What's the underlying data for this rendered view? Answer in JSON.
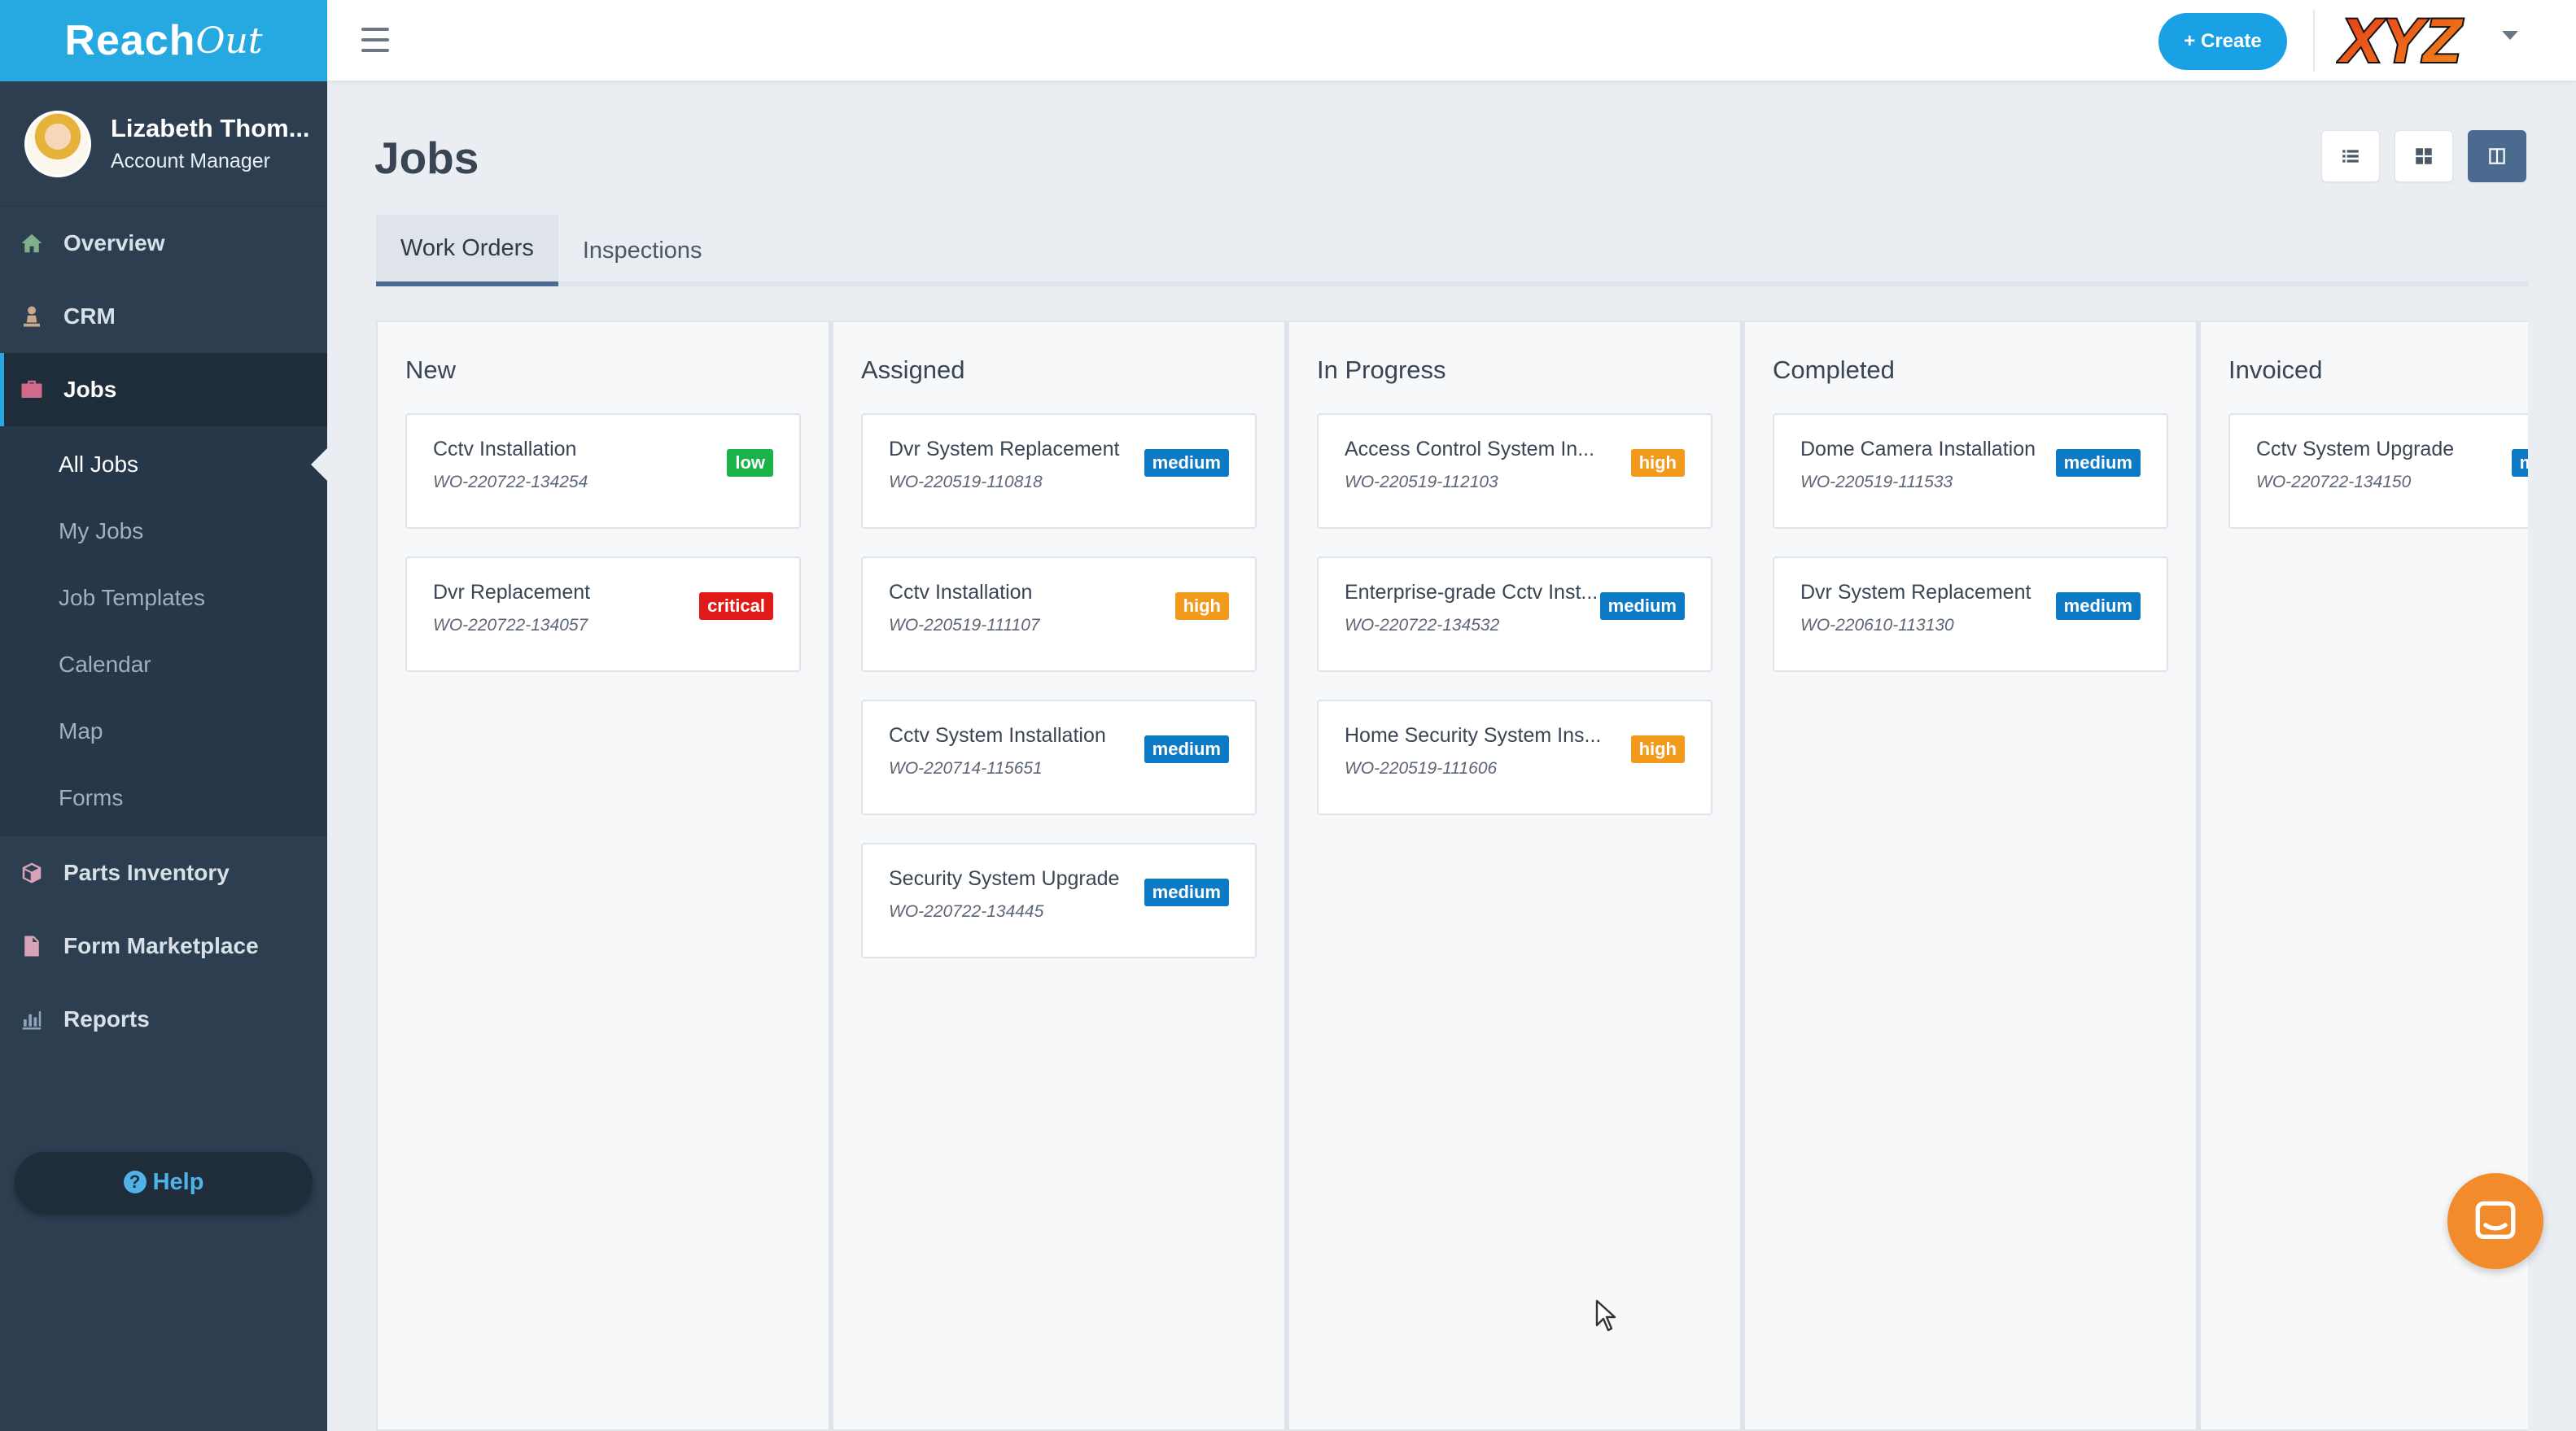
{
  "brand": {
    "logo_main": "Reach",
    "logo_tail": "Out",
    "color": "#25a9e0"
  },
  "user": {
    "name": "Lizabeth Thom...",
    "role": "Account Manager"
  },
  "nav": {
    "items": [
      {
        "label": "Overview",
        "icon": "home-icon"
      },
      {
        "label": "CRM",
        "icon": "person-icon"
      },
      {
        "label": "Jobs",
        "icon": "briefcase-icon"
      },
      {
        "label": "Parts Inventory",
        "icon": "box-icon"
      },
      {
        "label": "Form Marketplace",
        "icon": "document-icon"
      },
      {
        "label": "Reports",
        "icon": "bar-chart-icon"
      }
    ],
    "jobs_sub": [
      "All Jobs",
      "My Jobs",
      "Job Templates",
      "Calendar",
      "Map",
      "Forms"
    ]
  },
  "help": {
    "label": "Help"
  },
  "topbar": {
    "create_label": "+ Create",
    "company_logo": "XYZ"
  },
  "page": {
    "title": "Jobs"
  },
  "view_toggles": [
    "list-view-icon",
    "grid-view-icon",
    "board-view-icon"
  ],
  "tabs": [
    "Work Orders",
    "Inspections"
  ],
  "priority_colors": {
    "low": "#19b34a",
    "medium": "#0d7ac6",
    "high": "#f29a1c",
    "critical": "#e01919"
  },
  "board": {
    "columns": [
      {
        "title": "New",
        "cards": [
          {
            "title": "Cctv Installation",
            "code": "WO-220722-134254",
            "priority": "low"
          },
          {
            "title": "Dvr Replacement",
            "code": "WO-220722-134057",
            "priority": "critical"
          }
        ]
      },
      {
        "title": "Assigned",
        "cards": [
          {
            "title": "Dvr System Replacement",
            "code": "WO-220519-110818",
            "priority": "medium"
          },
          {
            "title": "Cctv Installation",
            "code": "WO-220519-111107",
            "priority": "high"
          },
          {
            "title": "Cctv System Installation",
            "code": "WO-220714-115651",
            "priority": "medium"
          },
          {
            "title": "Security System Upgrade",
            "code": "WO-220722-134445",
            "priority": "medium"
          }
        ]
      },
      {
        "title": "In Progress",
        "cards": [
          {
            "title": "Access Control System In...",
            "code": "WO-220519-112103",
            "priority": "high"
          },
          {
            "title": "Enterprise-grade Cctv Inst...",
            "code": "WO-220722-134532",
            "priority": "medium"
          },
          {
            "title": "Home Security System Ins...",
            "code": "WO-220519-111606",
            "priority": "high"
          }
        ]
      },
      {
        "title": "Completed",
        "cards": [
          {
            "title": "Dome Camera Installation",
            "code": "WO-220519-111533",
            "priority": "medium"
          },
          {
            "title": "Dvr System Replacement",
            "code": "WO-220610-113130",
            "priority": "medium"
          }
        ]
      },
      {
        "title": "Invoiced",
        "cards": [
          {
            "title": "Cctv System Upgrade",
            "code": "WO-220722-134150",
            "priority": "medium"
          }
        ]
      }
    ]
  }
}
